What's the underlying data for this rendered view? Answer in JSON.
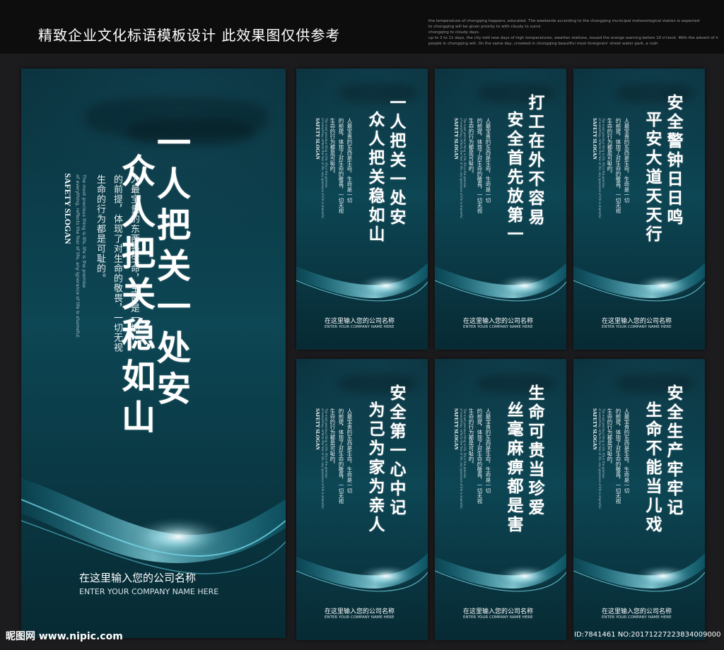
{
  "page_title": "精致企业文化标语模板设计 此效果图仅供参考",
  "fineprint": [
    "the temperature of chongqing happens, educated. The weekends according to the chongqing municipal meteorological station is expected",
    "to chongqing will be given priority to with cloudy to sunni",
    "chongqing to cloudy days.",
    "up to 3 to 11 days, the city told new days of high temperatures, weather stations, issued the orange warning before 10 o'clock. With the advent of high temperatures, more than a thousand",
    "people in chongqing will. On the same day, crowded in chongqing beautiful most foreigners' street water park, a rush"
  ],
  "poster_common": {
    "en_title": "SAFETY SLOGAN",
    "body_line1": "人最宝贵的东西是生命，生命是一切",
    "body_line2": "的前提，体现了对生命的敬畏，一切无视",
    "body_line3": "生命的行为都是可耻的。",
    "body_small1": "人最宝贵的东西是生命，生命是一切",
    "body_small2": "的前提，体现了对生命的敬畏，一切无视",
    "body_small3": "生命的行为都是可耻的。",
    "en_small1": "The most precious thing is life, life is the premise",
    "en_small2": "of everything, reflects the fear of life, any ignorance of life is shameful.",
    "company_cn": "在这里输入您的公司名称",
    "company_en": "ENTER YOUR COMPANY NAME HERE"
  },
  "large_poster": {
    "slogan_col1": "一人把关一处安",
    "slogan_col2": "众人把关稳如山"
  },
  "small_posters": [
    {
      "col1": "一人把关一处安",
      "col2": "众人把关稳如山"
    },
    {
      "col1": "打工在外不容易",
      "col2": "安全首先放第一"
    },
    {
      "col1": "安全警钟日日鸣",
      "col2": "平安大道天天行"
    },
    {
      "col1": "安全第一心中记",
      "col2": "为己为家为亲人"
    },
    {
      "col1": "生命可贵当珍爱",
      "col2": "丝毫麻痹都是害"
    },
    {
      "col1": "安全生产牢牢记",
      "col2": "生命不能当儿戏"
    }
  ],
  "footer": {
    "logo_text": "昵图网 www.nipic.com",
    "id_text": "ID:7841461 NO:20171227223834009000"
  }
}
